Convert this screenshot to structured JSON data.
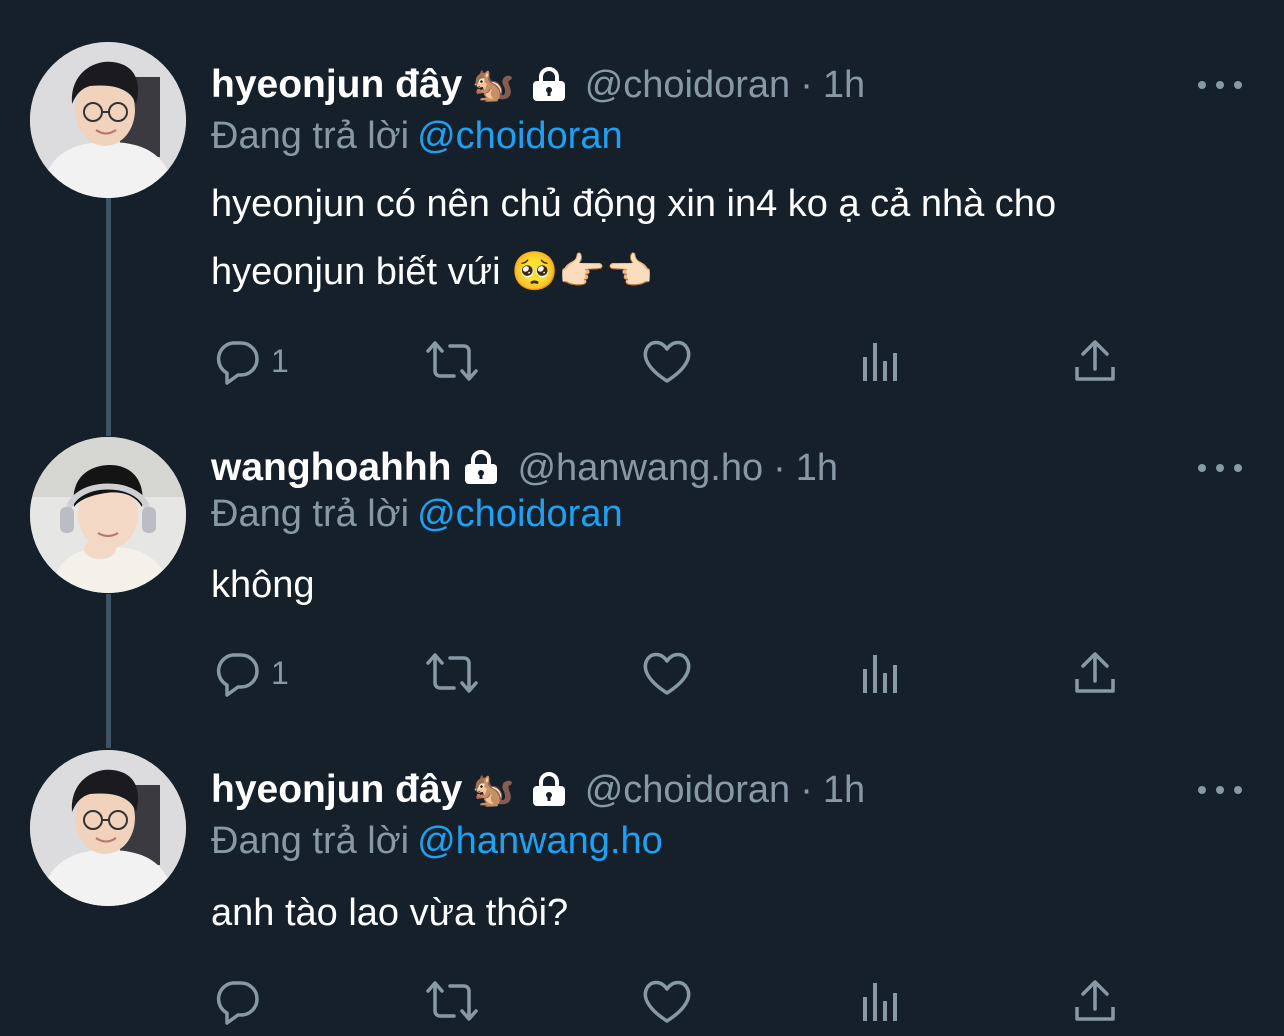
{
  "tweets": [
    {
      "name": "hyeonjun đây",
      "emoji": "🐿️",
      "handle": "@choidoran",
      "dot": "·",
      "time": "1h",
      "reply_prefix": "Đang trả lời",
      "reply_to": "@choidoran",
      "text_line1": "hyeonjun có nên chủ động xin in4 ko ạ cả nhà cho",
      "text_line2": "hyeonjun biết vứi 🥺👉🏻👈🏻",
      "reply_count": "1"
    },
    {
      "name": "wanghoahhh",
      "handle": "@hanwang.ho",
      "dot": "·",
      "time": "1h",
      "reply_prefix": "Đang trả lời",
      "reply_to": "@choidoran",
      "text_line1": "không",
      "reply_count": "1"
    },
    {
      "name": "hyeonjun đây",
      "emoji": "🐿️",
      "handle": "@choidoran",
      "dot": "·",
      "time": "1h",
      "reply_prefix": "Đang trả lời",
      "reply_to": "@hanwang.ho",
      "text_line1": "anh tào lao vừa thôi?",
      "reply_count": ""
    }
  ],
  "icons": {
    "reply": "reply-icon",
    "retweet": "retweet-icon",
    "like": "heart-icon",
    "stats": "analytics-icon",
    "share": "share-icon",
    "lock": "lock-icon",
    "more": "more-icon"
  },
  "colors": {
    "background": "#15202b",
    "secondary_text": "#8899a6",
    "mention": "#1da1f2",
    "thread_line": "#3d5466"
  }
}
